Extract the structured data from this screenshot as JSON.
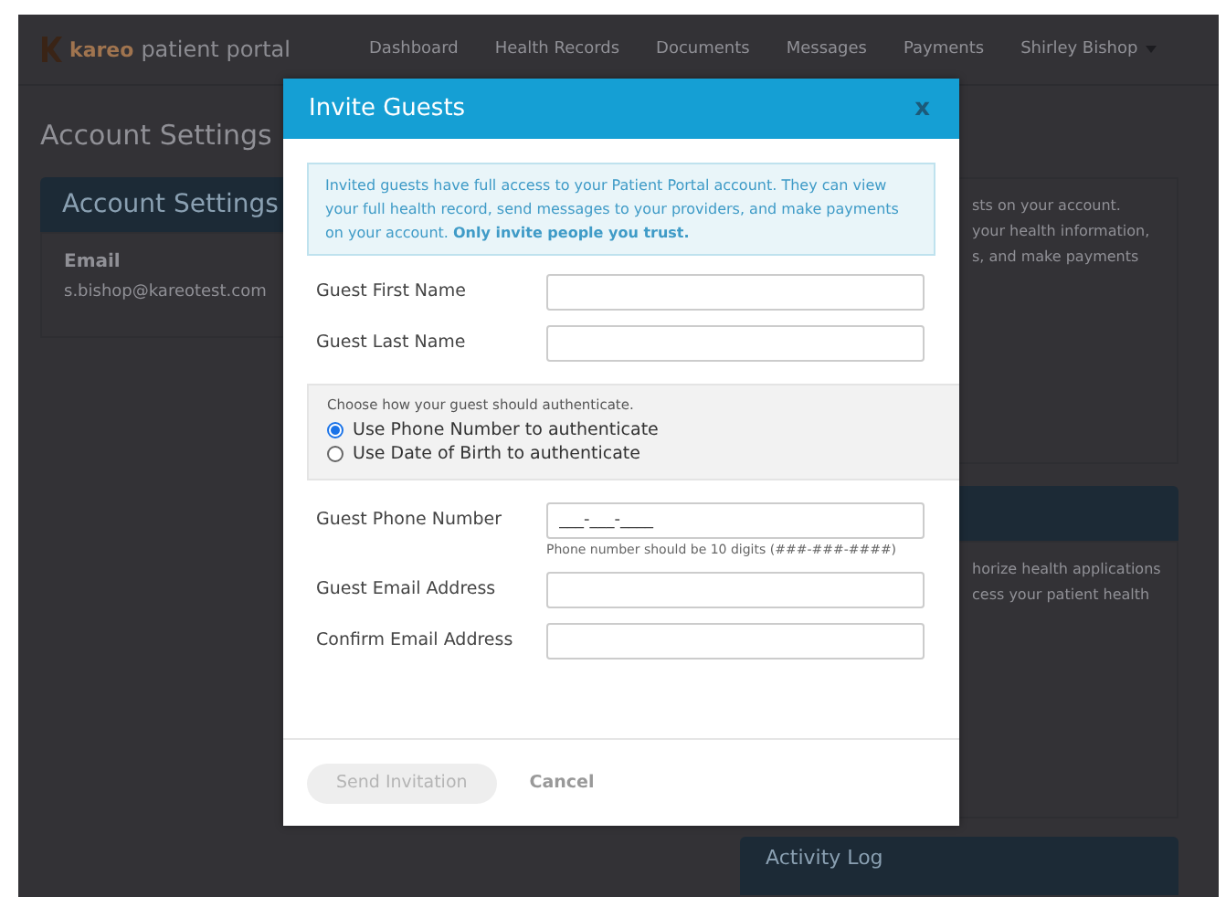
{
  "app": {
    "logo_brand": "kareo",
    "logo_product": "patient portal"
  },
  "nav": [
    {
      "label": "Dashboard"
    },
    {
      "label": "Health Records"
    },
    {
      "label": "Documents"
    },
    {
      "label": "Messages"
    },
    {
      "label": "Payments"
    },
    {
      "label": "Shirley Bishop",
      "kind": "dropdown"
    }
  ],
  "page_title": "Account Settings",
  "left_card": {
    "header": "Account Settings",
    "field_label": "Email",
    "field_value": "s.bishop@kareotest.com"
  },
  "right_cards": [
    {
      "lines": [
        "sts on your account.",
        "your health information,",
        "s, and make payments"
      ]
    },
    {
      "lines": [
        "horize health applications",
        "cess your patient health"
      ]
    },
    {
      "header": "Activity Log"
    }
  ],
  "modal": {
    "title": "Invite Guests",
    "close": "x",
    "notice": "Invited guests have full access to your Patient Portal account. They can view your full health record, send messages to your providers, and make payments on your account. **Only invite people you trust.**",
    "name_fields": [
      {
        "label": "Guest First Name"
      },
      {
        "label": "Guest Last Name"
      }
    ],
    "auth": {
      "prompt": "Choose how your guest should authenticate.",
      "options": [
        {
          "label": "Use Phone Number to authenticate",
          "selected": true
        },
        {
          "label": "Use Date of Birth to authenticate",
          "selected": false
        }
      ]
    },
    "contact_fields": [
      {
        "label": "Guest Phone Number",
        "value": "___-___-____",
        "hint": "Phone number should be 10 digits (###-###-####)"
      },
      {
        "label": "Guest Email Address"
      },
      {
        "label": "Confirm Email Address"
      }
    ],
    "send_button": {
      "label": "Send Invitation",
      "disabled": true
    },
    "cancel_button": {
      "label": "Cancel"
    }
  }
}
